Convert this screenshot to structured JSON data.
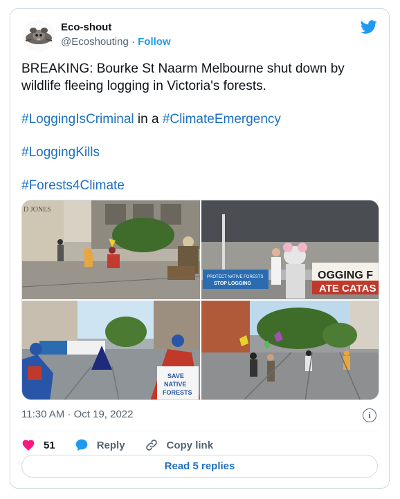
{
  "author": {
    "display_name": "Eco-shout",
    "handle": "@Ecoshouting",
    "separator": "·",
    "follow_label": "Follow"
  },
  "tweet": {
    "paragraphs": [
      {
        "segments": [
          {
            "text": "BREAKING: Bourke St Naarm Melbourne shut down by wildlife fleeing logging in Victoria's forests.",
            "tag": false
          }
        ]
      },
      {
        "segments": [
          {
            "text": "#LoggingIsCriminal",
            "tag": true
          },
          {
            "text": " in a ",
            "tag": false
          },
          {
            "text": "#ClimateEmergency",
            "tag": true
          }
        ]
      },
      {
        "segments": [
          {
            "text": "#LoggingKills",
            "tag": true
          }
        ]
      },
      {
        "segments": [
          {
            "text": "#Forests4Climate",
            "tag": true
          }
        ]
      }
    ],
    "timestamp": "11:30 AM · Oct 19, 2022"
  },
  "media": {
    "photos": [
      {
        "signs": [
          "D JONES"
        ]
      },
      {
        "signs": [
          "PROTECT NATIVE FORESTS",
          "STOP LOGGING",
          "OGGING F",
          "ATE CATAS"
        ]
      },
      {
        "signs": [
          "SAVE",
          "NATIVE",
          "FORESTS"
        ]
      },
      {
        "signs": []
      }
    ]
  },
  "actions": {
    "like_count": "51",
    "reply_label": "Reply",
    "copy_link_label": "Copy link",
    "read_replies_label": "Read 5 replies"
  },
  "icons": {
    "twitter": "twitter-bird-icon",
    "info": "info-icon",
    "like": "heart-icon",
    "reply": "speech-bubble-icon",
    "copy": "link-icon"
  },
  "colors": {
    "link": "#1d70c2",
    "twitter_blue": "#1d9bf0",
    "heart": "#f91880",
    "muted": "#536471"
  }
}
